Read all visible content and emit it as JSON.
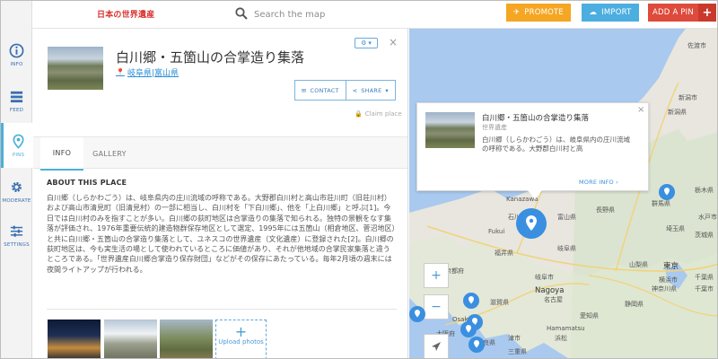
{
  "header": {
    "site_title": "日本の世界遺産",
    "search_placeholder": "Search the map",
    "promote_label": "PROMOTE",
    "import_label": "IMPORT",
    "add_pin_label": "ADD A PIN",
    "add_pin_plus": "+",
    "colors": {
      "promote": "#f5a623",
      "import": "#4caee0",
      "add_pin": "#de4a3b"
    }
  },
  "sidebar": {
    "items": [
      {
        "label": "INFO",
        "icon": "info-icon"
      },
      {
        "label": "FEED",
        "icon": "feed-icon"
      },
      {
        "label": "PINS",
        "icon": "pin-icon",
        "active": true
      },
      {
        "label": "MODERATE",
        "icon": "gear-icon"
      },
      {
        "label": "SETTINGS",
        "icon": "sliders-icon"
      }
    ]
  },
  "place": {
    "title": "白川郷・五箇山の合掌造り集落",
    "location": "岐阜県|富山県",
    "contact_label": "CONTACT",
    "share_label": "SHARE",
    "claim_label": "Claim place",
    "close": "×"
  },
  "tabs": [
    {
      "label": "INFO",
      "active": true
    },
    {
      "label": "GALLERY"
    }
  ],
  "about": {
    "heading": "ABOUT THIS PLACE",
    "body": "白川郷（しらかわごう）は、岐阜県内の庄川流域の呼称である。大野郡白川村と高山市荘川町（旧荘川村）および高山市清見町（旧清見村）の一部に相当し、白川村を「下白川郷」、他を「上白川郷」と呼ぶ[1]。今日では白川村のみを指すことが多い。白川郷の荻町地区は合掌造りの集落で知られる。独特の景観をなす集落が評価され、1976年重要伝統的建造物群保存地区として選定、1995年には五箇山（相倉地区、菅沼地区）と共に白川郷・五箇山の合掌造り集落として、ユネスコの世界遺産（文化遺産）に登録された[2]。白川郷の荻町地区は、今も実生活の場として使われているところに価値があり、それが他地域の合掌民家集落と違うところである。「世界遺産白川郷合掌造り保存財団」などがその保存にあたっている。毎年2月頃の週末には夜間ライトアップが行われる。"
  },
  "gallery": {
    "upload_plus": "+",
    "upload_label": "Upload photos"
  },
  "popup": {
    "title": "白川郷・五箇山の合掌造り集落",
    "subtitle": "世界遺産",
    "description": "白川郷（しらかわごう）は、岐阜県内の庄川流域の呼称である。大野郡白川村と高",
    "more_label": "MORE INFO",
    "close": "×"
  },
  "map": {
    "zoom_in": "+",
    "zoom_out": "−",
    "labels": {
      "kanazawa": "Kanazawa",
      "fukui": "Fukui",
      "nagoya": "Nagoya",
      "nagoya_jp": "名古屋",
      "osaka": "Osaka",
      "tokyo_jp": "東京",
      "hamamatsu": "Hamamatsu",
      "hamamatsu_jp": "浜松",
      "niigata_jp": "新潟県",
      "nagano_jp": "長野県",
      "gifu_jp": "岐阜県",
      "gunma_jp": "群馬県",
      "tochigi_jp": "栃木県",
      "saitama_jp": "埼玉県",
      "chiba_jp": "千葉県",
      "shizuoka_jp": "静岡県",
      "aichi_jp": "愛知県",
      "yamanashi_jp": "山梨県",
      "ibaraki_jp": "茨城県",
      "kanagawa_jp": "神奈川県",
      "fukui_jp": "福井県",
      "kyoto_jp": "京都府",
      "nara_jp": "奈良県",
      "mie_jp": "三重県",
      "shiga_jp": "滋賀県",
      "ishikawa_jp": "石川県",
      "sado_jp": "佐渡市",
      "tsu_jp": "津市",
      "gifu_city": "岐阜市",
      "yokohama_jp": "横浜市",
      "mito_jp": "水戸市",
      "chiba_city_jp": "千葉市",
      "niigata_city_jp": "新潟市",
      "toyama_jp": "富山県",
      "osaka_jp": "大阪府",
      "kobe_jp": "神戸"
    }
  }
}
